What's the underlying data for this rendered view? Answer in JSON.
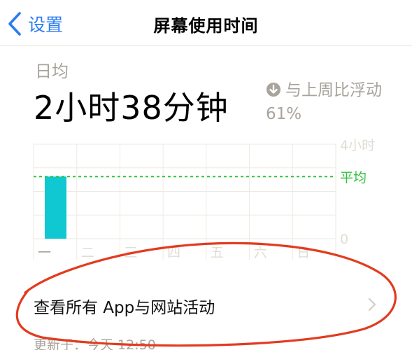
{
  "nav": {
    "back_label": "设置",
    "title": "屏幕使用时间"
  },
  "summary": {
    "label": "日均",
    "value": "2小时38分钟",
    "compare_icon": "arrow-down-circle-icon",
    "compare_text": "与上周比浮动61%"
  },
  "chart_data": {
    "type": "bar",
    "categories": [
      "一",
      "二",
      "三",
      "四",
      "五",
      "六",
      "日"
    ],
    "values": [
      2.63,
      0,
      0,
      0,
      0,
      0,
      0
    ],
    "ylim": [
      0,
      4
    ],
    "y_tick_labels": [
      "0",
      "4小时"
    ],
    "average_value": 2.63,
    "average_label": "平均",
    "grid": true,
    "colors": {
      "bar": "#0fc8d2",
      "average_line": "#2fc23a",
      "grid": "#eeeae3",
      "labels": "#e2ddd4"
    }
  },
  "link": {
    "label": "查看所有 App与网站活动",
    "chevron_icon": "chevron-right-icon"
  },
  "footer": {
    "updated": "更新于：今天 12:50"
  },
  "colors": {
    "accent": "#2b7cf0",
    "secondary_text": "#a8a39b",
    "annotation": "#e23b1f"
  }
}
